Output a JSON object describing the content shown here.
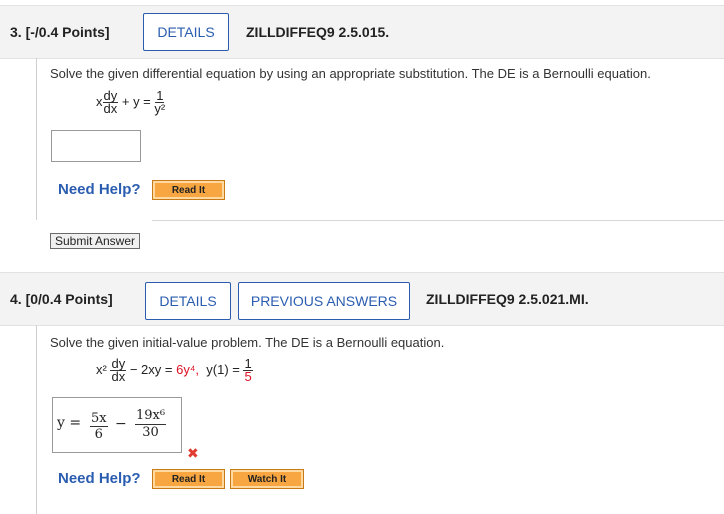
{
  "q3": {
    "header": "3.  [-/0.4 Points]",
    "details_label": "DETAILS",
    "code": "ZILLDIFFEQ9 2.5.015.",
    "instruction": "Solve the given differential equation by using an appropriate substitution. The DE is a Bernoulli equation.",
    "eq_x": "x",
    "eq_dy": "dy",
    "eq_dx": "dx",
    "eq_plus_y": "+ y =",
    "eq_one": "1",
    "eq_y2": "y²",
    "answer_value": "",
    "need_help": "Need Help?",
    "read_it": "Read It",
    "submit": "Submit Answer"
  },
  "q4": {
    "header": "4.  [0/0.4 Points]",
    "details_label": "DETAILS",
    "prev_answers_label": "PREVIOUS ANSWERS",
    "code": "ZILLDIFFEQ9 2.5.021.MI.",
    "instruction": "Solve the given initial-value problem. The DE is a Bernoulli equation.",
    "eq_x2": "x²",
    "eq_dy": "dy",
    "eq_dx": "dx",
    "eq_minus": "− 2xy =",
    "eq_rhs": "6y⁴,",
    "eq_cond": "y(1) =",
    "eq_cond_num": "1",
    "eq_cond_den": "5",
    "ans_y": "y =",
    "ans_t1_num": "5x",
    "ans_t1_den": "6",
    "ans_minus": "−",
    "ans_t2_num": "19x⁶",
    "ans_t2_den": "30",
    "incorrect_mark": "✖",
    "need_help": "Need Help?",
    "read_it": "Read It",
    "watch_it": "Watch It"
  }
}
